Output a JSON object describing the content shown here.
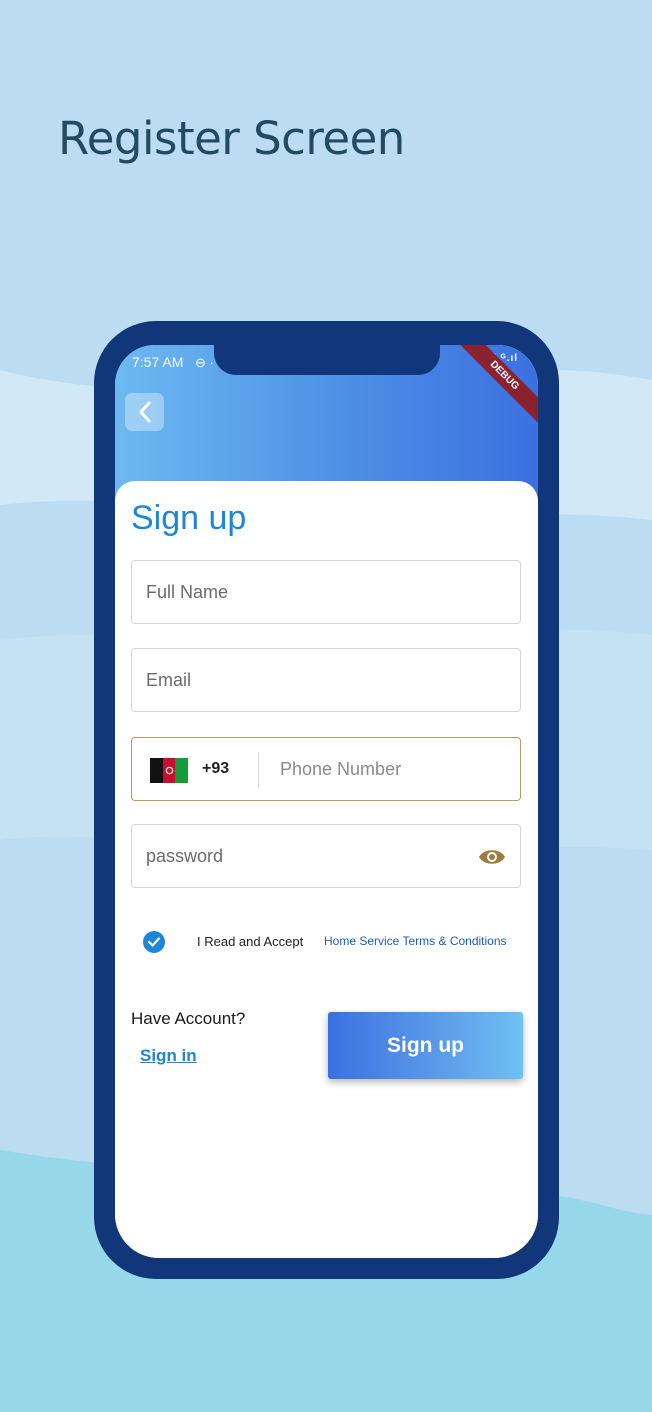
{
  "heading": "Register Screen",
  "status_bar": {
    "time": "7:57 AM",
    "dnd_glyph": "⊖ ·",
    "right": "ıl ᴳ.ıl",
    "debug_banner": "DEBUG"
  },
  "signup_form": {
    "title": "Sign up",
    "full_name_placeholder": "Full Name",
    "email_placeholder": "Email",
    "phone": {
      "flag": "afghanistan-flag",
      "dial_code": "+93",
      "placeholder": "Phone Number"
    },
    "password_placeholder": "password",
    "accept_label": "I Read and Accept",
    "terms_link": "Home Service Terms & Conditions",
    "accept_checked": true,
    "have_account_label": "Have Account?",
    "signin_link": "Sign in",
    "signup_button": "Sign up"
  },
  "colors": {
    "background": "#bcdcf1",
    "heading": "#234a5e",
    "phone_frame": "#12367a",
    "primary_blue": "#1e86d8",
    "phone_field_border": "#b59a63",
    "eye_icon": "#a07a3a"
  }
}
